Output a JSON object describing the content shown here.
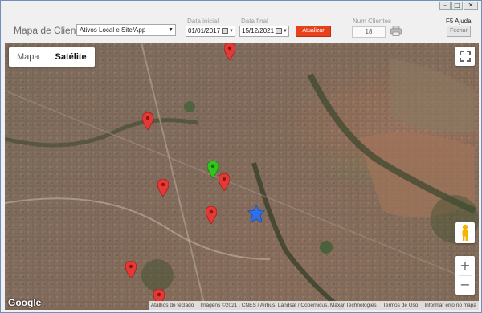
{
  "window": {
    "minimize_glyph": "–",
    "maximize_glyph": "□",
    "close_glyph": "✕"
  },
  "toolbar": {
    "title": "Mapa de Clientes",
    "filter_value": "Ativos Local e Site/App",
    "date_start_label": "Data inicial",
    "date_start_value": "01/01/2017",
    "date_end_label": "Data final",
    "date_end_value": "15/12/2021",
    "refresh_label": "Atualizar",
    "num_clients_label": "Num Clientes",
    "num_clients_value": "18",
    "help_label": "F5  Ajuda",
    "close_label": "Fechar",
    "icons": [
      "calendar-icon",
      "printer-icon"
    ],
    "refresh_color": "#e8401a"
  },
  "map": {
    "type_map_label": "Mapa",
    "type_satellite_label": "Satélite",
    "zoom_in_label": "+",
    "zoom_out_label": "−",
    "logo_text": "Google",
    "attribution": {
      "shortcuts": "Atalhos do teclado",
      "imagery": "Imagens ©2021 , CNES / Airbus, Landsat / Copernicus, Maxar Technologies",
      "terms": "Termos de Uso",
      "report": "Informar erro no mapa"
    },
    "icons": [
      "fullscreen-icon",
      "pegman-icon",
      "red-pin-icon",
      "green-pin-icon",
      "blue-location-icon"
    ],
    "pin_color_red": "#e53935",
    "pin_color_green": "#34c31d",
    "pin_color_blue": "#2f6fe8"
  }
}
